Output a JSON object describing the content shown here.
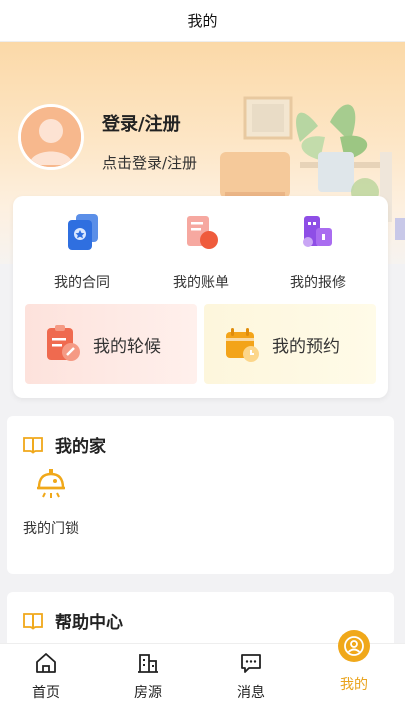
{
  "header": {
    "title": "我的"
  },
  "profile": {
    "title": "登录/注册",
    "subtitle": "点击登录/注册"
  },
  "quick": {
    "contract": "我的合同",
    "bill": "我的账单",
    "repair": "我的报修",
    "queue": "我的轮候",
    "appointment": "我的预约"
  },
  "home_section": {
    "title": "我的家",
    "lock_label": "我的门锁"
  },
  "help_section": {
    "title": "帮助中心"
  },
  "tabs": [
    {
      "label": "首页",
      "icon": "home-icon"
    },
    {
      "label": "房源",
      "icon": "building-icon"
    },
    {
      "label": "消息",
      "icon": "message-icon"
    },
    {
      "label": "我的",
      "icon": "user-icon"
    }
  ],
  "colors": {
    "accent": "#f0a81a",
    "hero": "#fbd9a8"
  }
}
